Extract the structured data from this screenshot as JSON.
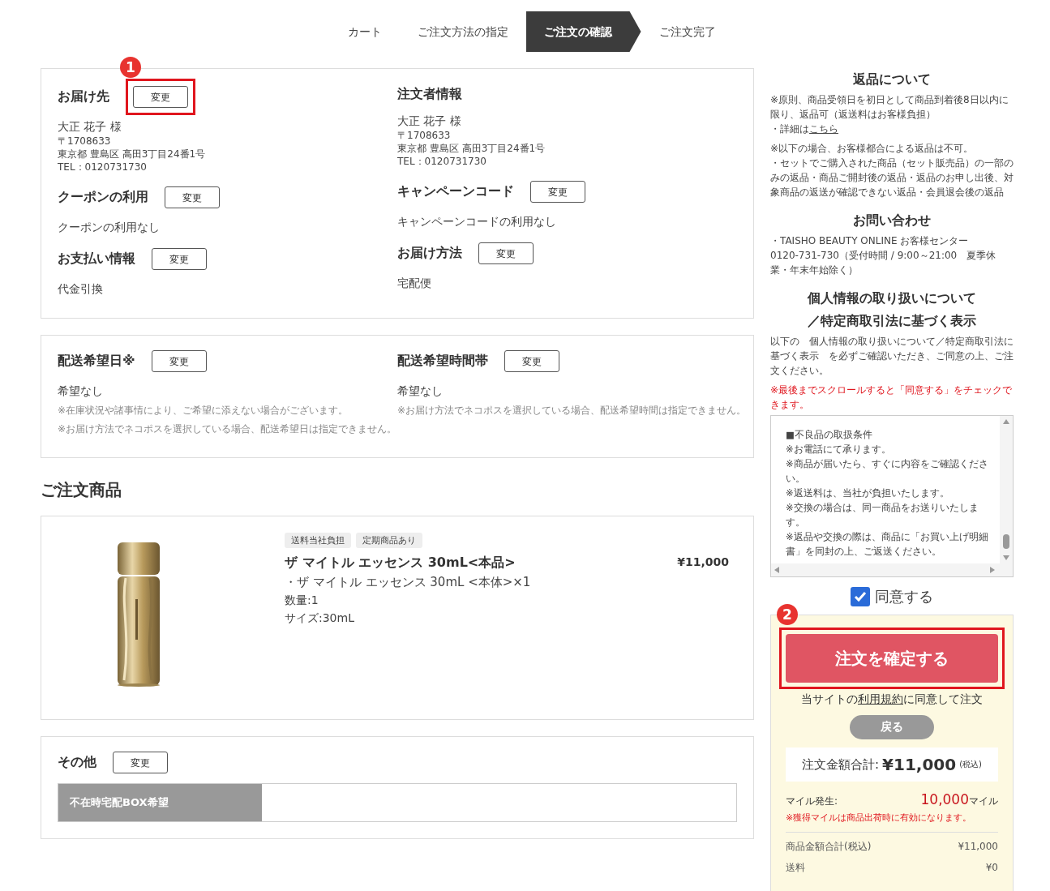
{
  "steps": [
    {
      "label": "カート",
      "selected": false
    },
    {
      "label": "ご注文方法の指定",
      "selected": false
    },
    {
      "label": "ご注文の確認",
      "selected": true
    },
    {
      "label": "ご注文完了",
      "selected": false
    }
  ],
  "info_panel": {
    "columns": [
      [
        {
          "title": "お届け先",
          "button": "変更",
          "marker": "1",
          "lines": [
            {
              "kind": "name",
              "text": "大正 花子 様"
            },
            {
              "kind": "small",
              "text": "〒1708633"
            },
            {
              "kind": "small",
              "text": "東京都 豊島区 高田3丁目24番1号"
            },
            {
              "kind": "small",
              "text": "TEL：0120731730"
            }
          ]
        },
        {
          "title": "クーポンの利用",
          "button": "変更",
          "lines": [
            {
              "kind": "value",
              "text": "クーポンの利用なし"
            }
          ]
        },
        {
          "title": "お支払い情報",
          "button": "変更",
          "lines": [
            {
              "kind": "value",
              "text": "代金引換"
            }
          ]
        }
      ],
      [
        {
          "title": "注文者情報",
          "lines": [
            {
              "kind": "name",
              "text": "大正 花子 様"
            },
            {
              "kind": "small",
              "text": "〒1708633"
            },
            {
              "kind": "small",
              "text": "東京都 豊島区 高田3丁目24番1号"
            },
            {
              "kind": "small",
              "text": "TEL：0120731730"
            }
          ]
        },
        {
          "title": "キャンペーンコード",
          "button": "変更",
          "lines": [
            {
              "kind": "value",
              "text": "キャンペーンコードの利用なし"
            }
          ]
        },
        {
          "title": "お届け方法",
          "button": "変更",
          "lines": [
            {
              "kind": "value",
              "text": "宅配便"
            }
          ]
        }
      ]
    ]
  },
  "delivery_panel": {
    "columns": [
      [
        {
          "title": "配送希望日※",
          "button": "変更",
          "lines": [
            {
              "kind": "value",
              "text": "希望なし"
            },
            {
              "kind": "note",
              "text": "※在庫状況や諸事情により、ご希望に添えない場合がございます。"
            },
            {
              "kind": "note",
              "text": "※お届け方法でネコポスを選択している場合、配送希望日は指定できません。"
            }
          ]
        }
      ],
      [
        {
          "title": "配送希望時間帯",
          "button": "変更",
          "lines": [
            {
              "kind": "value",
              "text": "希望なし"
            },
            {
              "kind": "note",
              "text": "※お届け方法でネコポスを選択している場合、配送希望時間は指定できません。"
            }
          ]
        }
      ]
    ]
  },
  "products_heading": "ご注文商品",
  "product": {
    "image": {
      "kind": "picture"
    },
    "tags": [
      "送料当社負担",
      "定期商品あり"
    ],
    "name": "ザ マイトル エッセンス 30mL<本品>",
    "detail": "・ザ マイトル エッセンス 30mL <本体>×1",
    "quantity": "数量:1",
    "size": "サイズ:30mL",
    "price": "¥11,000"
  },
  "other_panel": {
    "title": "その他",
    "button": "変更",
    "field_label": "不在時宅配BOX希望"
  },
  "sidebar": {
    "returns": {
      "title": "返品について",
      "paragraphs": [
        "※原則、商品受領日を初日として商品到着後8日以内に限り、返品可（返送料はお客様負担）"
      ],
      "detail_prefix": "・詳細は",
      "detail_link": "こちら",
      "conditions": [
        "※以下の場合、お客様都合による返品は不可。",
        "・セットでご購入された商品（セット販売品）の一部のみの返品・商品ご開封後の返品・返品のお申し出後、対象商品の返送が確認できない返品・会員退会後の返品"
      ]
    },
    "contact": {
      "title": "お問い合わせ",
      "lines": [
        "・TAISHO BEAUTY ONLINE お客様センター",
        "0120-731-730（受付時間 / 9:00～21:00　夏季休業・年末年始除く）"
      ]
    },
    "privacy": {
      "title_lines": [
        "個人情報の取り扱いについて",
        "／特定商取引法に基づく表示"
      ],
      "text": "以下の　個人情報の取り扱いについて／特定商取引法に基づく表示　を必ずご確認いただき、ご同意の上、ご注文ください。",
      "warning": "※最後までスクロールすると「同意する」をチェックできます。"
    },
    "terms_box": {
      "lines": [
        "■不良品の取扱条件",
        "※お電話にて承ります。",
        "※商品が届いたら、すぐに内容をご確認ください。",
        "※返送料は、当社が負担いたします。",
        "※交換の場合は、同一商品をお送りいたします。",
        "※返品や交換の際は、商品に「お買い上げ明細書」を同封の上、ご返送ください。"
      ]
    },
    "agree": {
      "label": "同意する",
      "checked": true
    },
    "order_box": {
      "marker": "2",
      "confirm_button": "注文を確定する",
      "terms_prefix": "当サイトの",
      "terms_link": "利用規約",
      "terms_suffix": "に同意して注文",
      "back_button": "戻る",
      "total_label": "注文金額合計:",
      "total_value": "¥11,000",
      "total_tax": "(税込)",
      "miles_label": "マイル発生:",
      "miles_value": "10,000",
      "miles_unit": "マイル",
      "miles_note": "※獲得マイルは商品出荷時に有効になります。",
      "summary": [
        {
          "label": "商品金額合計(税込)",
          "value": "¥11,000"
        },
        {
          "label": "送料",
          "value": "¥0"
        }
      ]
    }
  }
}
